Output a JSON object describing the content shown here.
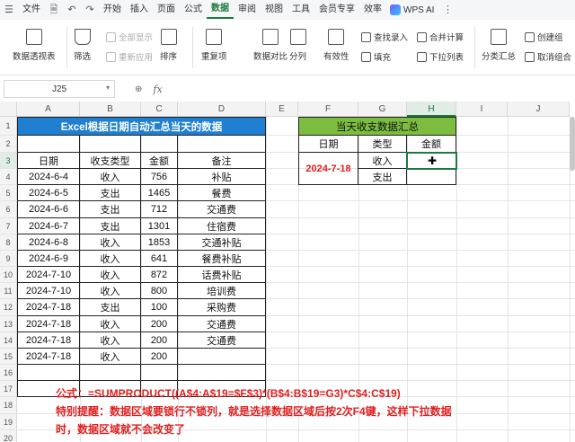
{
  "menu": {
    "file": "文件",
    "items": [
      "开始",
      "插入",
      "页面",
      "公式",
      "数据",
      "审阅",
      "视图",
      "工具",
      "会员专享",
      "效率"
    ],
    "active": "数据",
    "wps_ai": "WPS AI"
  },
  "ribbon": {
    "pivot": "数据透视表",
    "filter": "筛选",
    "show_all": "全部显示",
    "reapply": "重新应用",
    "sort": "排序",
    "dup": "重复项",
    "compare": "数据对比",
    "split": "分列",
    "valid": "有效性",
    "lookup": "查找录入",
    "fill": "填充",
    "merge": "合并计算",
    "dropdown": "下拉列表",
    "subtotal": "分类汇总",
    "group": "创建组",
    "ungroup": "取消组合"
  },
  "formula_bar": {
    "name_box": "J25",
    "fx": "fx",
    "zoom_icon": "zoom-icon"
  },
  "columns": [
    "A",
    "B",
    "C",
    "D",
    "E",
    "F",
    "G",
    "H",
    "I",
    "J"
  ],
  "rows": [
    "1",
    "2",
    "3",
    "4",
    "5",
    "6",
    "7",
    "8",
    "9",
    "10",
    "11",
    "12",
    "13",
    "14",
    "15",
    "16",
    "17",
    "18",
    "19",
    "20"
  ],
  "table1": {
    "title": "Excel根据日期自动汇总当天的数据",
    "headers": [
      "日期",
      "收支类型",
      "金额",
      "备注"
    ],
    "data": [
      [
        "2024-6-4",
        "收入",
        "756",
        "补贴"
      ],
      [
        "2024-6-5",
        "支出",
        "1465",
        "餐费"
      ],
      [
        "2024-6-6",
        "支出",
        "712",
        "交通费"
      ],
      [
        "2024-6-7",
        "支出",
        "1301",
        "住宿费"
      ],
      [
        "2024-6-8",
        "收入",
        "1853",
        "交通补贴"
      ],
      [
        "2024-6-9",
        "收入",
        "641",
        "餐费补贴"
      ],
      [
        "2024-7-10",
        "收入",
        "872",
        "话费补贴"
      ],
      [
        "2024-7-10",
        "收入",
        "800",
        "培训费"
      ],
      [
        "2024-7-18",
        "支出",
        "100",
        "采购费"
      ],
      [
        "2024-7-18",
        "收入",
        "200",
        "交通费"
      ],
      [
        "2024-7-18",
        "收入",
        "200",
        "交通费"
      ],
      [
        "2024-7-18",
        "收入",
        "200",
        ""
      ]
    ]
  },
  "table2": {
    "title": "当天收支数据汇总",
    "headers": [
      "日期",
      "类型",
      "金额"
    ],
    "date": "2024-7-18",
    "types": [
      "收入",
      "支出"
    ]
  },
  "notes": {
    "formula": "公式：=SUMPRODUCT((A$4:A$19=$F$3)*(B$4:B$19=G3)*C$4:C$19)",
    "tip1": "特别提醒：数据区域要锁行不锁列，就是选择数据区域后按2次F4键，这样下拉数据",
    "tip2": "时，数据区域就不会改变了"
  },
  "colors": {
    "accent": "#1c7a3a",
    "title1_bg": "#1f7fd0",
    "title2_bg": "#7cbc3f",
    "note": "#e02020"
  }
}
